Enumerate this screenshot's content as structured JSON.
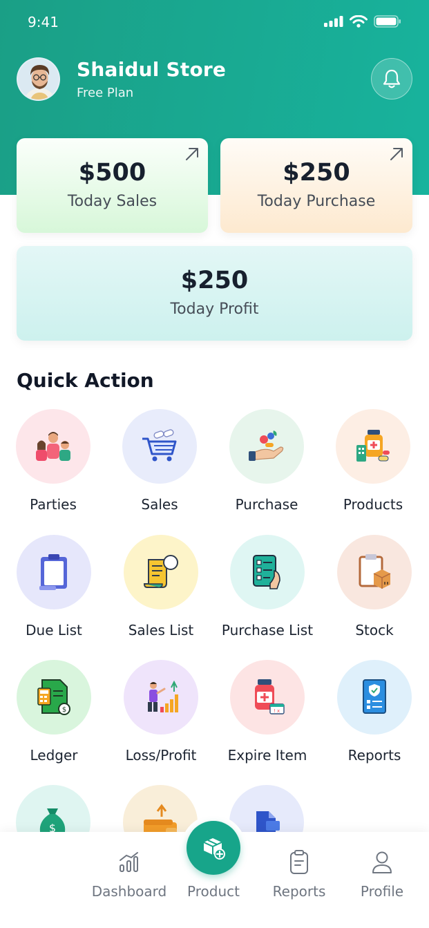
{
  "status_bar": {
    "time": "9:41"
  },
  "header": {
    "store_name": "Shaidul Store",
    "plan": "Free Plan"
  },
  "stats": {
    "sales": {
      "amount": "$500",
      "label": "Today Sales"
    },
    "purchase": {
      "amount": "$250",
      "label": "Today Purchase"
    },
    "profit": {
      "amount": "$250",
      "label": "Today Profit"
    }
  },
  "quick_action": {
    "title": "Quick Action",
    "items": [
      {
        "label": "Parties",
        "icon": "family-icon",
        "bg": "#fde6ea"
      },
      {
        "label": "Sales",
        "icon": "cart-icon",
        "bg": "#e8ecfb"
      },
      {
        "label": "Purchase",
        "icon": "hand-pills-icon",
        "bg": "#e7f5ec"
      },
      {
        "label": "Products",
        "icon": "medicine-bottle-icon",
        "bg": "#fdeee4"
      },
      {
        "label": "Due List",
        "icon": "clipboard-icon",
        "bg": "#e6e7fb"
      },
      {
        "label": "Sales List",
        "icon": "receipt-icon",
        "bg": "#fdf4c9"
      },
      {
        "label": "Purchase List",
        "icon": "checklist-icon",
        "bg": "#dff6f3"
      },
      {
        "label": "Stock",
        "icon": "stock-box-icon",
        "bg": "#f9e7df"
      },
      {
        "label": "Ledger",
        "icon": "ledger-icon",
        "bg": "#d9f5dd"
      },
      {
        "label": "Loss/Profit",
        "icon": "growth-chart-icon",
        "bg": "#efe4fb"
      },
      {
        "label": "Expire Item",
        "icon": "expire-medicine-icon",
        "bg": "#fde4e4"
      },
      {
        "label": "Reports",
        "icon": "report-doc-icon",
        "bg": "#dff0fb"
      },
      {
        "label": "",
        "icon": "money-bag-icon",
        "bg": "#dff5f1"
      },
      {
        "label": "",
        "icon": "wallet-icon",
        "bg": "#f9eed9"
      },
      {
        "label": "",
        "icon": "document-icon",
        "bg": "#e6eafb"
      }
    ]
  },
  "bottom_nav": {
    "items": [
      {
        "label": "Dashboard",
        "icon": "bar-chart-icon"
      },
      {
        "label": "Product",
        "icon": "box-add-icon"
      },
      {
        "label": "Reports",
        "icon": "clipboard-list-icon"
      },
      {
        "label": "Profile",
        "icon": "user-icon"
      }
    ],
    "active": "Product",
    "accent": "#17a58a"
  }
}
